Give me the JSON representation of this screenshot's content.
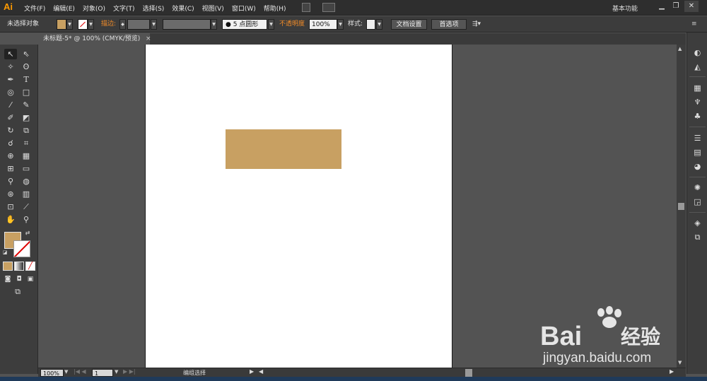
{
  "app": {
    "logo_text": "Ai",
    "workspace_label": "基本功能",
    "window_controls": [
      "minimize-icon",
      "restore-icon",
      "close-icon"
    ]
  },
  "menu": {
    "items": [
      "文件(F)",
      "编辑(E)",
      "对象(O)",
      "文字(T)",
      "选择(S)",
      "效果(C)",
      "视图(V)",
      "窗口(W)",
      "帮助(H)"
    ]
  },
  "control_bar": {
    "selection_status": "未选择对象",
    "stroke_label": "描边:",
    "brush_value": "5 点圆形",
    "opacity_label": "不透明度",
    "opacity_value": "100%",
    "style_label": "样式:",
    "doc_setup_button": "文档设置",
    "preferences_button": "首选项"
  },
  "document": {
    "tab_title": "未标题-5* @ 100% (CMYK/预览)",
    "close_glyph": "×"
  },
  "status_bar": {
    "zoom_value": "100%",
    "page_value": "1",
    "status_text": "编组选择"
  },
  "colors": {
    "fill": "#c8a062",
    "accent": "#f28c28",
    "artboard": "#ffffff",
    "pasteboard": "#535353"
  },
  "watermark": {
    "brand": "Bai",
    "brand_suffix": "经验",
    "url": "jingyan.baidu.com"
  }
}
